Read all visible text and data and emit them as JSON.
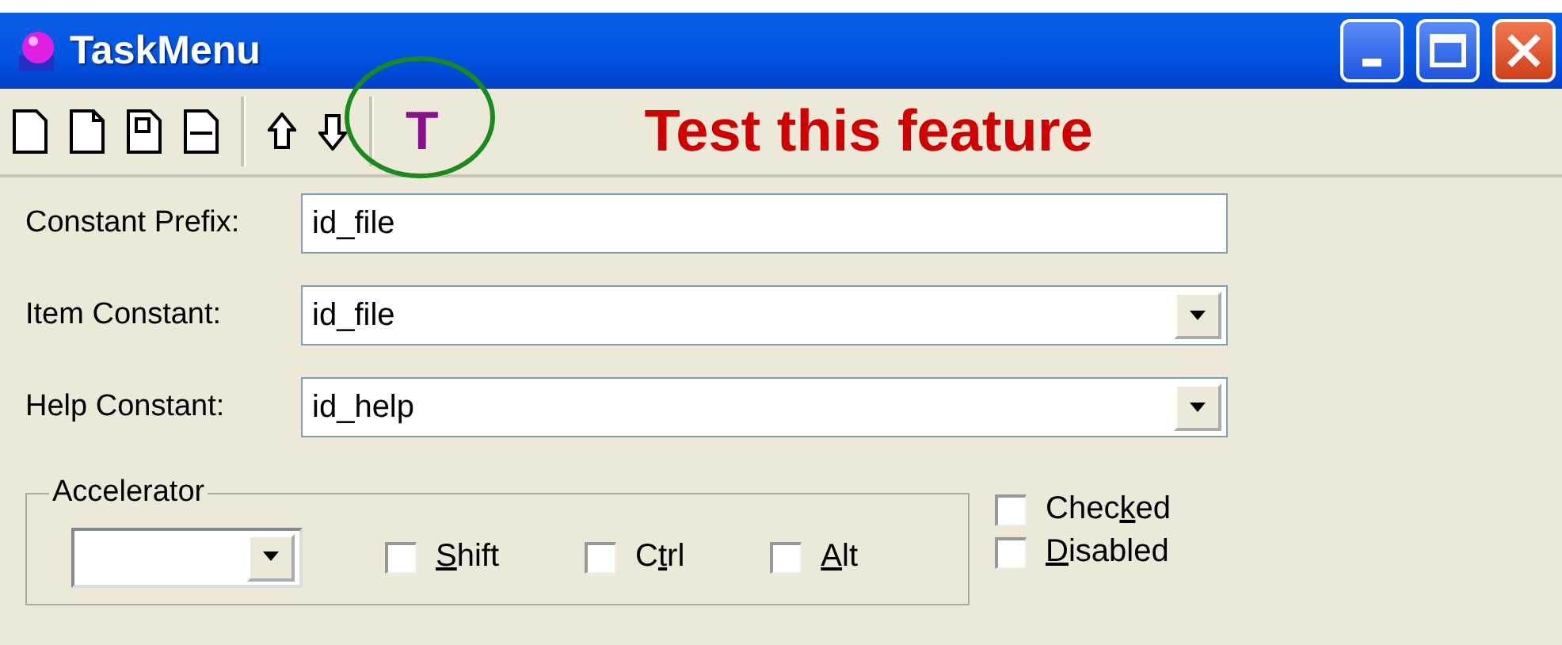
{
  "window": {
    "title": "TaskMenu"
  },
  "toolbar": {
    "text_button": "T",
    "annotation": "Test this feature"
  },
  "fields": [
    {
      "label": "Constant Prefix:",
      "value": "id_file",
      "kind": "text"
    },
    {
      "label": "Item Constant:",
      "value": "id_file",
      "kind": "combo"
    },
    {
      "label": "Help Constant:",
      "value": "id_help",
      "kind": "combo"
    }
  ],
  "accelerator": {
    "title": "Accelerator",
    "modifiers": [
      {
        "key": "S",
        "after": "hift",
        "checked": false
      },
      {
        "before": "C",
        "key": "t",
        "after": "rl",
        "checked": false
      },
      {
        "key": "A",
        "after": "lt",
        "checked": false
      }
    ]
  },
  "options": [
    {
      "before": "Chec",
      "key": "k",
      "after": "ed",
      "checked": false
    },
    {
      "key": "D",
      "after": "isabled",
      "checked": false
    }
  ]
}
